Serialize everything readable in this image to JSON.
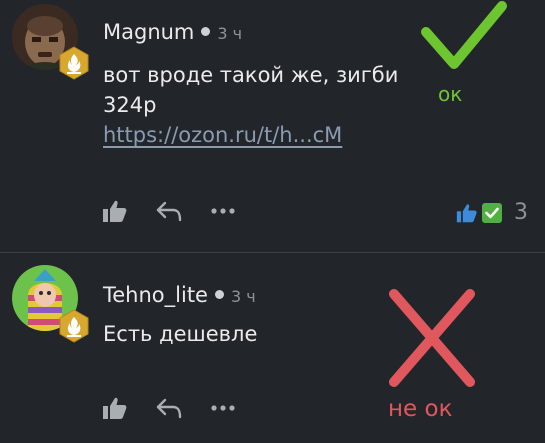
{
  "comments": [
    {
      "author": "Magnum",
      "time": "3 ч",
      "text": "вот вроде такой же, зигби 324р",
      "link": "https://ozon.ru/t/h...cM",
      "reaction_count": "3"
    },
    {
      "author": "Tehno_lite",
      "time": "3 ч",
      "text": "Есть дешевле"
    }
  ],
  "annotations": {
    "ok_label": "ок",
    "not_ok_label": "не ок",
    "ok_color": "#6dc52f",
    "not_ok_color": "#e0585e"
  },
  "icons": {
    "like": "thumbs-up-icon",
    "reply": "reply-arrow-icon",
    "more": "more-dots-icon",
    "badge": "flame-badge-icon"
  },
  "colors": {
    "background": "#22262b",
    "link": "#8a9bb0",
    "muted": "#8d9399",
    "badge": "#d8a72e"
  }
}
